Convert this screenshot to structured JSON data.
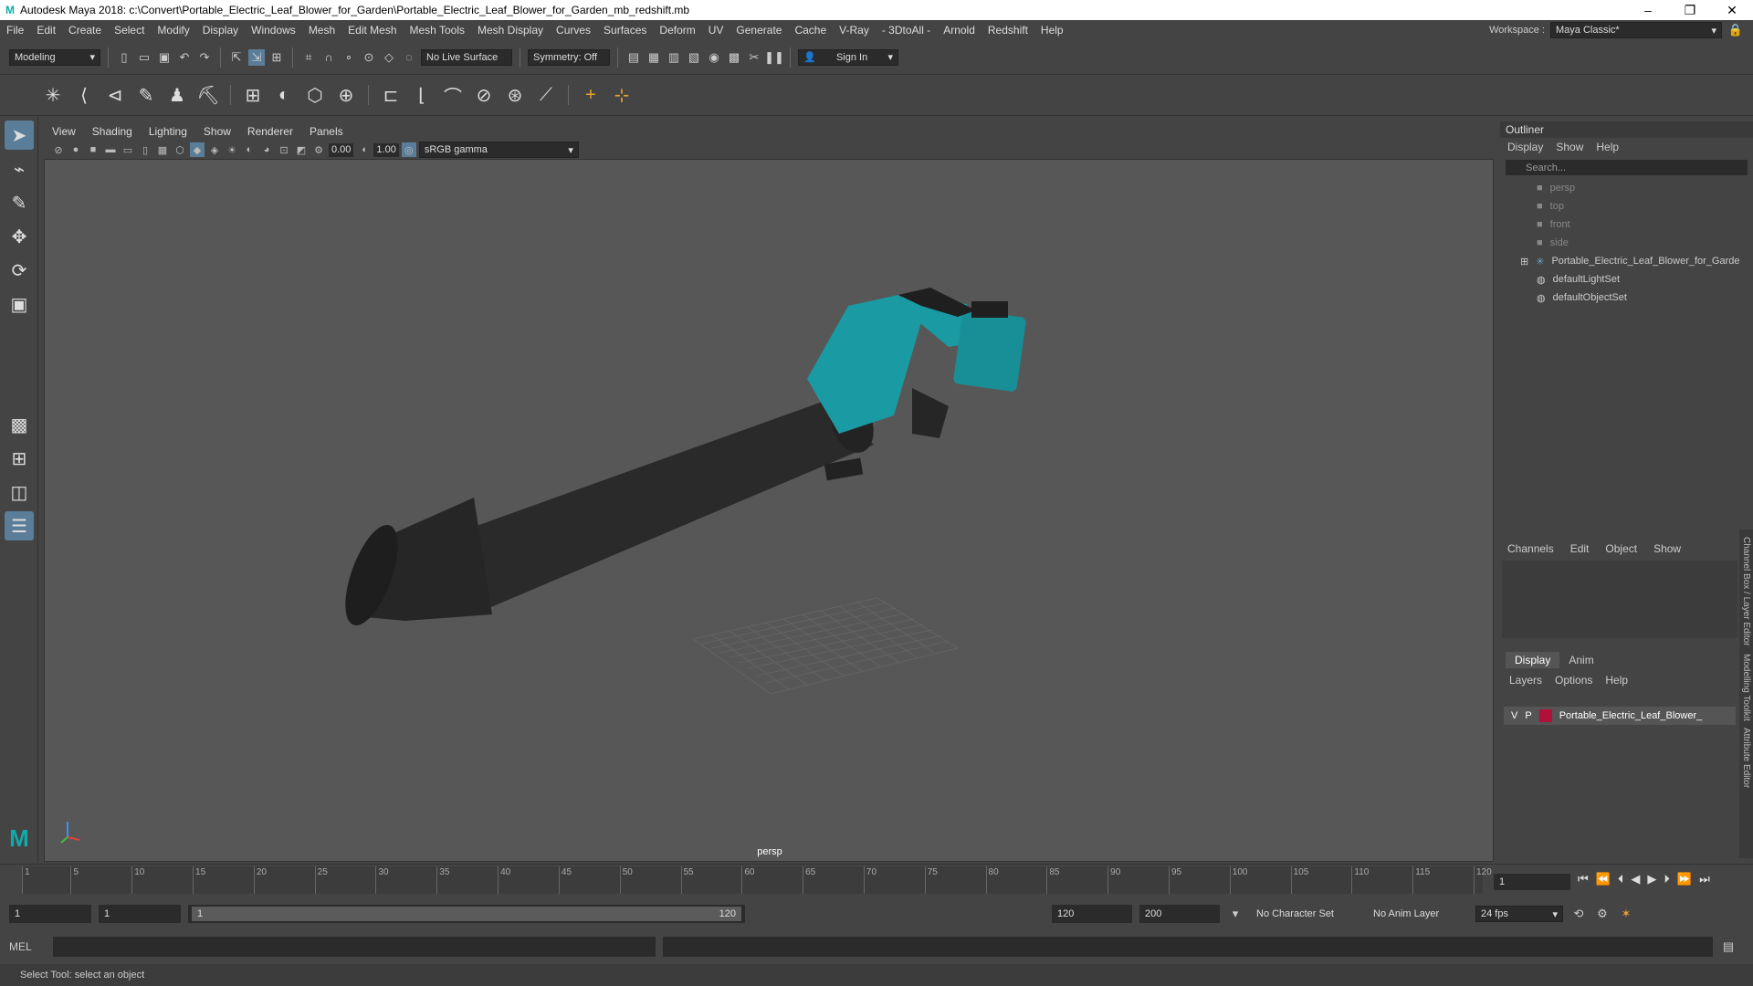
{
  "window": {
    "title": "Autodesk Maya 2018: c:\\Convert\\Portable_Electric_Leaf_Blower_for_Garden\\Portable_Electric_Leaf_Blower_for_Garden_mb_redshift.mb"
  },
  "menubar": {
    "items": [
      "File",
      "Edit",
      "Create",
      "Select",
      "Modify",
      "Display",
      "Windows",
      "Mesh",
      "Edit Mesh",
      "Mesh Tools",
      "Mesh Display",
      "Curves",
      "Surfaces",
      "Deform",
      "UV",
      "Generate",
      "Cache",
      "V-Ray",
      "- 3DtoAll -",
      "Arnold",
      "Redshift",
      "Help"
    ],
    "workspace_label": "Workspace :",
    "workspace_value": "Maya Classic*"
  },
  "statusline": {
    "mode": "Modeling",
    "live_surface": "No Live Surface",
    "symmetry": "Symmetry: Off",
    "sign_in": "Sign In"
  },
  "viewport": {
    "menu": [
      "View",
      "Shading",
      "Lighting",
      "Show",
      "Renderer",
      "Panels"
    ],
    "exposure": "0.00",
    "gamma": "1.00",
    "color_space": "sRGB gamma",
    "camera_label": "persp"
  },
  "outliner": {
    "title": "Outliner",
    "menu": [
      "Display",
      "Show",
      "Help"
    ],
    "search_placeholder": "Search...",
    "items": [
      {
        "label": "persp",
        "dim": true
      },
      {
        "label": "top",
        "dim": true
      },
      {
        "label": "front",
        "dim": true
      },
      {
        "label": "side",
        "dim": true
      },
      {
        "label": "Portable_Electric_Leaf_Blower_for_Garde",
        "dim": false
      },
      {
        "label": "defaultLightSet",
        "dim": false
      },
      {
        "label": "defaultObjectSet",
        "dim": false
      }
    ]
  },
  "channelbox": {
    "menu": [
      "Channels",
      "Edit",
      "Object",
      "Show"
    ]
  },
  "layers": {
    "tabs": [
      "Display",
      "Anim"
    ],
    "menu": [
      "Layers",
      "Options",
      "Help"
    ],
    "row": {
      "v": "V",
      "p": "P",
      "name": "Portable_Electric_Leaf_Blower_",
      "color": "#b0103a"
    }
  },
  "sidetabs": [
    "Channel Box / Layer Editor",
    "Modelling Toolkit",
    "Attribute Editor"
  ],
  "timeline": {
    "ticks": [
      "1",
      "5",
      "10",
      "15",
      "20",
      "25",
      "30",
      "35",
      "40",
      "45",
      "50",
      "55",
      "60",
      "65",
      "70",
      "75",
      "80",
      "85",
      "90",
      "95",
      "100",
      "105",
      "110",
      "115",
      "120"
    ],
    "current_frame": "1"
  },
  "range": {
    "start": "1",
    "anim_start": "1",
    "slider_start": "1",
    "slider_end": "120",
    "end": "120",
    "anim_end": "200",
    "character_set": "No Character Set",
    "anim_layer": "No Anim Layer",
    "fps": "24 fps"
  },
  "command": {
    "language": "MEL"
  },
  "help": {
    "text": "Select Tool: select an object"
  },
  "colors": {
    "teal": "#1a9aa3",
    "body": "#2a2a2a"
  }
}
